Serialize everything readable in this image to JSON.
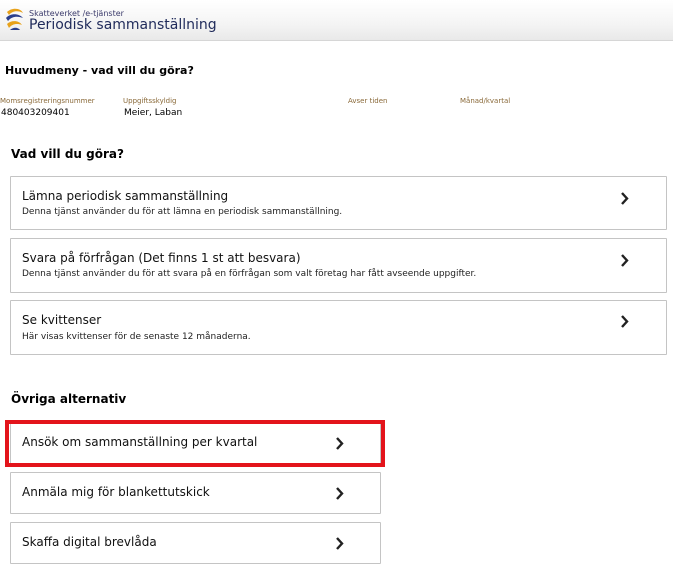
{
  "header": {
    "subtitle": "Skatteverket /e-tjänster",
    "title": "Periodisk sammanställning"
  },
  "main_heading": "Huvudmeny - vad vill du göra?",
  "info": {
    "labels": [
      "Momsregistreringsnummer",
      "Uppgiftsskyldig",
      "Avser tiden",
      "Månad/kvartal"
    ],
    "values": [
      "480403209401",
      "Meier, Laban",
      "",
      ""
    ]
  },
  "section1": {
    "heading": "Vad vill du göra?",
    "items": [
      {
        "title": "Lämna periodisk sammanställning",
        "desc": "Denna tjänst använder du för att lämna en periodisk sammanställning."
      },
      {
        "title": "Svara på förfrågan (Det finns 1 st att besvara)",
        "desc": "Denna tjänst använder du för att svara på en förfrågan som valt företag har fått avseende uppgifter."
      },
      {
        "title": "Se kvittenser",
        "desc": "Här visas kvittenser för de senaste 12 månaderna."
      }
    ]
  },
  "section2": {
    "heading": "Övriga alternativ",
    "items": [
      {
        "title": "Ansök om sammanställning per kvartal"
      },
      {
        "title": "Anmäla mig för blankettutskick"
      },
      {
        "title": "Skaffa digital brevlåda"
      }
    ]
  },
  "colors": {
    "highlight": "#e3141b",
    "brand_title": "#1f2a5a",
    "info_label": "#8a6a3a"
  },
  "icons": {
    "logo": "skatteverket-logo-icon",
    "chevron": "chevron-right-icon"
  }
}
